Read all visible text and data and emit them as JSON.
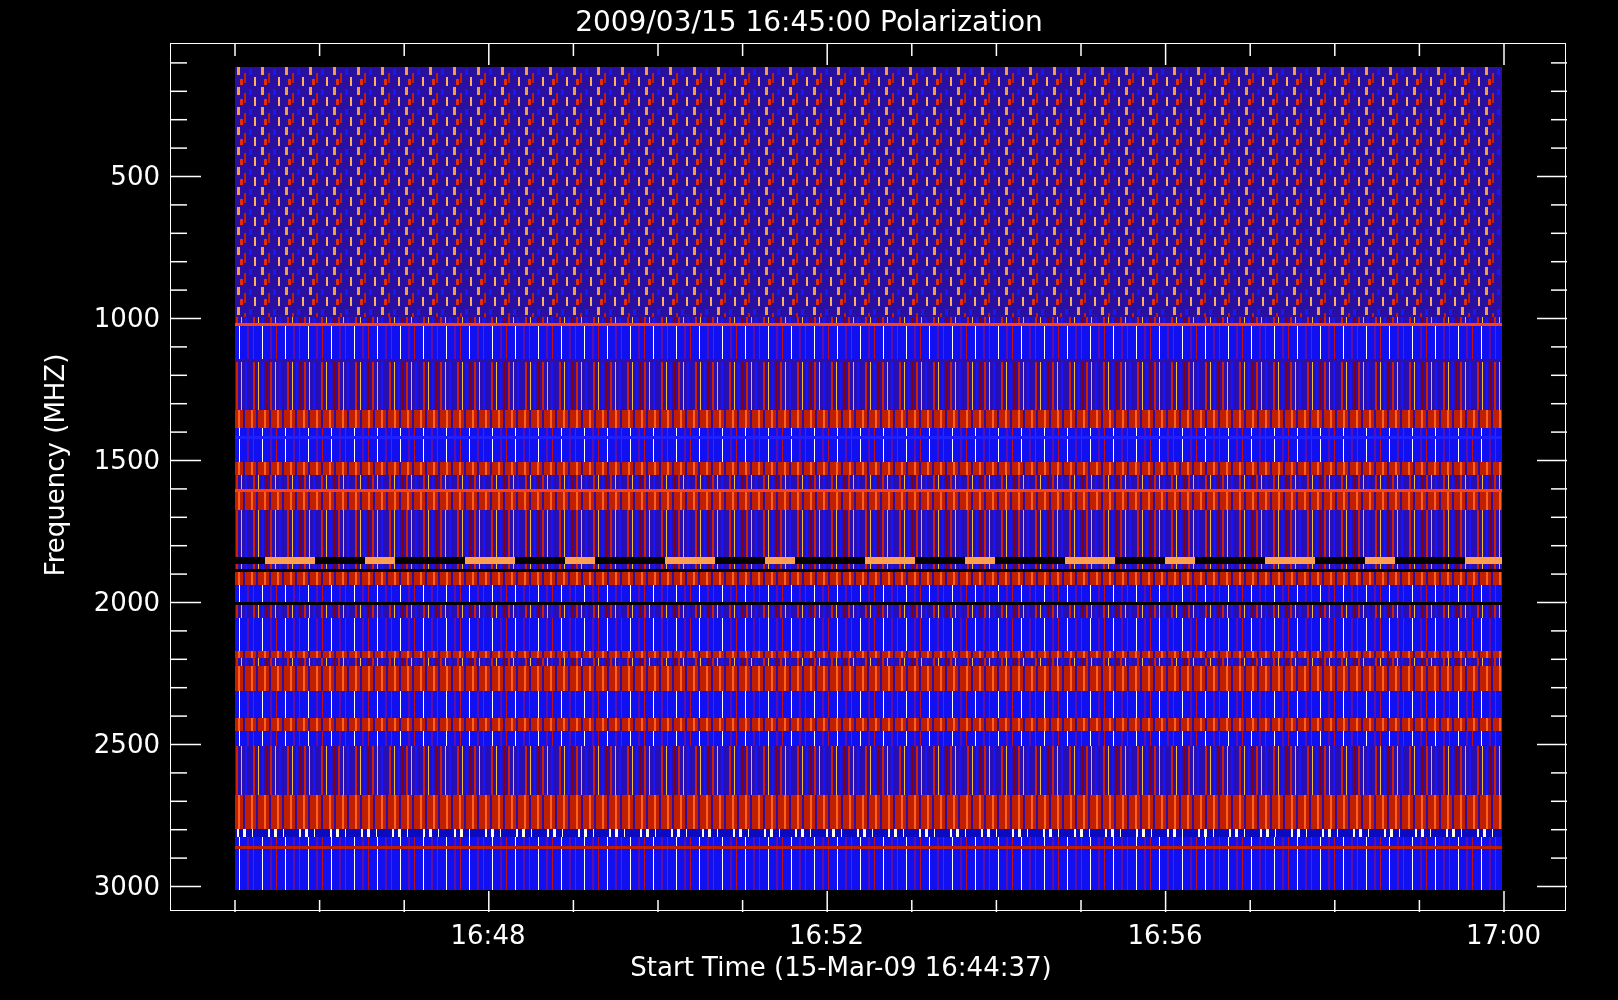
{
  "plot": {
    "title": "2009/03/15 16:45:00 Polarization",
    "ylabel": "Frequency (MHZ)",
    "yticks": [
      "500",
      "1000",
      "1500",
      "2000",
      "2500",
      "3000"
    ],
    "xticks": [
      "16:48",
      "16:52",
      "16:56",
      "17:00"
    ],
    "xlabel": "Start Time (15-Mar-09 16:44:37)"
  }
}
